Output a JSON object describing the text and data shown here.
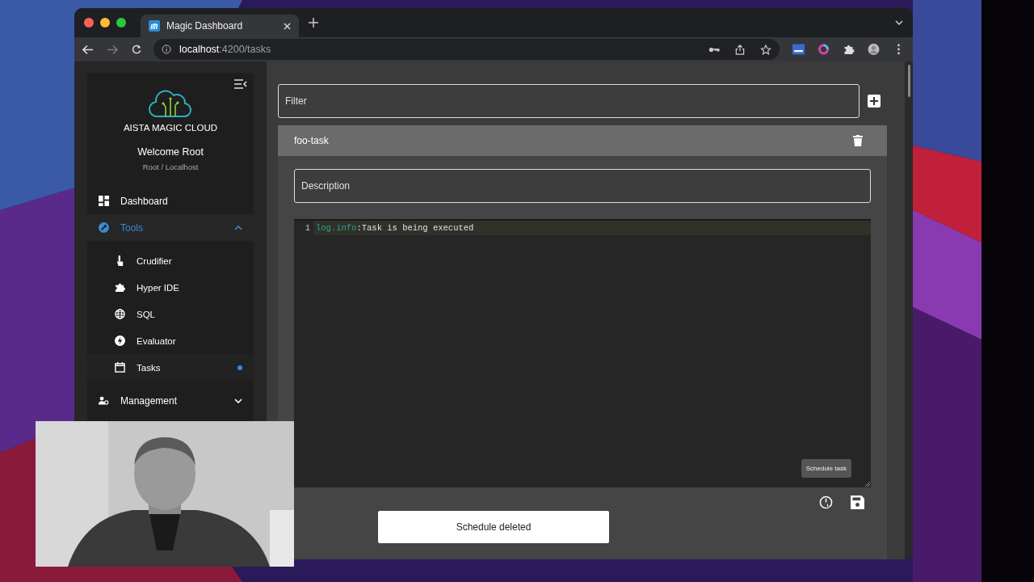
{
  "browser": {
    "tabs": [
      {
        "title": "Magic Dashboard",
        "selected": true
      }
    ],
    "address": {
      "host": "localhost",
      "path": ":4200/tasks"
    }
  },
  "sidebar": {
    "brand": "AISTA MAGIC CLOUD",
    "welcome": "Welcome Root",
    "user": "Root / Localhost",
    "items": [
      {
        "label": "Dashboard",
        "kind": "link",
        "selected": false
      },
      {
        "label": "Tools",
        "kind": "group",
        "selected": true,
        "expanded": true,
        "children": [
          {
            "label": "Crudifier",
            "selected": false
          },
          {
            "label": "Hyper IDE",
            "selected": false
          },
          {
            "label": "SQL",
            "selected": false
          },
          {
            "label": "Evaluator",
            "selected": false
          },
          {
            "label": "Tasks",
            "selected": true
          }
        ]
      },
      {
        "label": "Management",
        "kind": "group",
        "selected": false,
        "expanded": false
      }
    ]
  },
  "main": {
    "filter": {
      "placeholder": "Filter"
    },
    "tasks": [
      {
        "name": "foo-task",
        "expanded": true,
        "description": {
          "placeholder": "Description"
        },
        "code": [
          {
            "number": "1",
            "node": "log.info",
            "value": ":Task is being executed"
          }
        ],
        "tooltip": "Schedule task"
      }
    ]
  },
  "snackbar": "Schedule deleted"
}
